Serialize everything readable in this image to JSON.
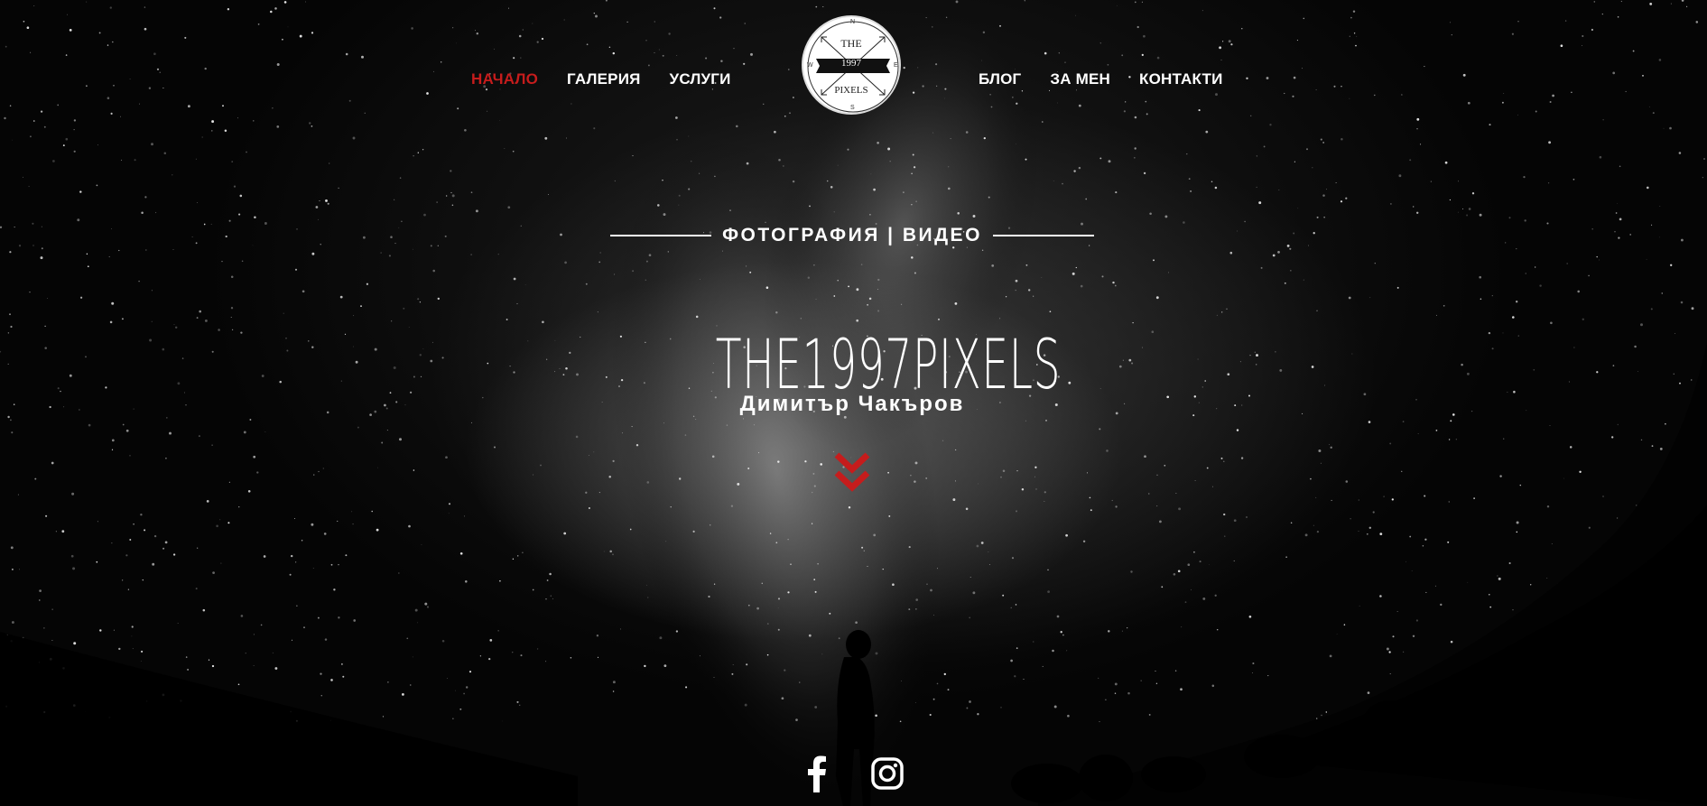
{
  "nav": {
    "left": [
      {
        "label": "НАЧАЛО",
        "active": true
      },
      {
        "label": "ГАЛЕРИЯ",
        "active": false
      },
      {
        "label": "УСЛУГИ",
        "active": false
      }
    ],
    "right": [
      {
        "label": "БЛОГ",
        "active": false
      },
      {
        "label": "ЗА МЕН",
        "active": false
      },
      {
        "label": "КОНТАКТИ",
        "active": false
      }
    ]
  },
  "logo": {
    "line1": "THE",
    "year": "1997",
    "line2": "PIXELS",
    "compass_n": "N",
    "compass_s": "S",
    "compass_w": "W",
    "compass_e": "E"
  },
  "hero": {
    "tagline": "ФОТОГРАФИЯ | ВИДЕО",
    "brand": "THE1997PIXELS",
    "subtitle": "Димитър Чакъров"
  },
  "social": {
    "items": [
      "facebook-icon",
      "instagram-icon"
    ]
  },
  "colors": {
    "accent": "#c61c1c",
    "text": "#ffffff",
    "background": "#050505"
  }
}
